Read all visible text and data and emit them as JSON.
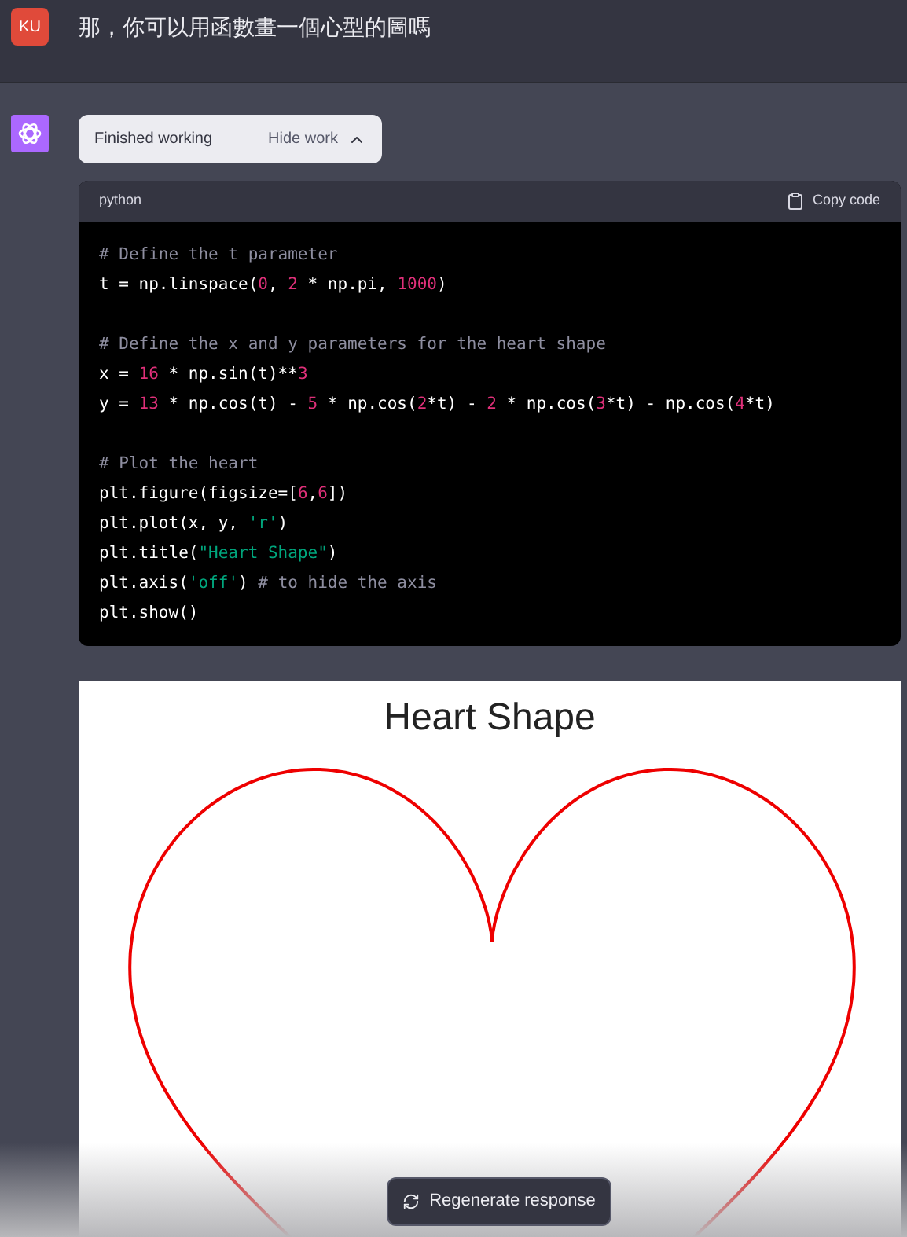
{
  "user_message": {
    "avatar": "KU",
    "text": "那，你可以用函數畫一個心型的圖嗎"
  },
  "assistant": {
    "work_status": {
      "label": "Finished working",
      "toggle": "Hide work",
      "expanded": true
    },
    "code_block": {
      "language": "python",
      "copy_label": "Copy code",
      "blocks": [
        [
          [
            {
              "kind": "comment",
              "text": "# Define the t parameter"
            }
          ],
          [
            {
              "kind": "plain",
              "text": "t = np.linspace("
            },
            {
              "kind": "number",
              "text": "0"
            },
            {
              "kind": "plain",
              "text": ", "
            },
            {
              "kind": "number",
              "text": "2"
            },
            {
              "kind": "plain",
              "text": " * np.pi, "
            },
            {
              "kind": "number",
              "text": "1000"
            },
            {
              "kind": "plain",
              "text": ")"
            }
          ]
        ],
        [
          [
            {
              "kind": "comment",
              "text": "# Define the x and y parameters for the heart shape"
            }
          ],
          [
            {
              "kind": "plain",
              "text": "x = "
            },
            {
              "kind": "number",
              "text": "16"
            },
            {
              "kind": "plain",
              "text": " * np.sin(t)**"
            },
            {
              "kind": "number",
              "text": "3"
            }
          ],
          [
            {
              "kind": "plain",
              "text": "y = "
            },
            {
              "kind": "number",
              "text": "13"
            },
            {
              "kind": "plain",
              "text": " * np.cos(t) - "
            },
            {
              "kind": "number",
              "text": "5"
            },
            {
              "kind": "plain",
              "text": " * np.cos("
            },
            {
              "kind": "number",
              "text": "2"
            },
            {
              "kind": "plain",
              "text": "*t) - "
            },
            {
              "kind": "number",
              "text": "2"
            },
            {
              "kind": "plain",
              "text": " * np.cos("
            },
            {
              "kind": "number",
              "text": "3"
            },
            {
              "kind": "plain",
              "text": "*t) - np.cos("
            },
            {
              "kind": "number",
              "text": "4"
            },
            {
              "kind": "plain",
              "text": "*t)"
            }
          ]
        ],
        [
          [
            {
              "kind": "comment",
              "text": "# Plot the heart"
            }
          ],
          [
            {
              "kind": "plain",
              "text": "plt.figure(figsize=["
            },
            {
              "kind": "number_list",
              "text": "6,6"
            },
            {
              "kind": "plain",
              "text": "])"
            }
          ],
          [
            {
              "kind": "plain",
              "text": "plt.plot(x, y, "
            },
            {
              "kind": "string",
              "text": "'r'"
            },
            {
              "kind": "plain",
              "text": ")"
            }
          ],
          [
            {
              "kind": "plain",
              "text": "plt.title("
            },
            {
              "kind": "string",
              "text": "\"Heart Shape\""
            },
            {
              "kind": "plain",
              "text": ")"
            }
          ],
          [
            {
              "kind": "plain",
              "text": "plt.axis("
            },
            {
              "kind": "string",
              "text": "'off'"
            },
            {
              "kind": "plain",
              "text": ") "
            },
            {
              "kind": "comment",
              "text": "# to hide the axis"
            }
          ],
          [
            {
              "kind": "plain",
              "text": "plt.show()"
            }
          ]
        ]
      ]
    },
    "plot": {
      "title": "Heart Shape"
    }
  },
  "regenerate_button": "Regenerate response"
}
